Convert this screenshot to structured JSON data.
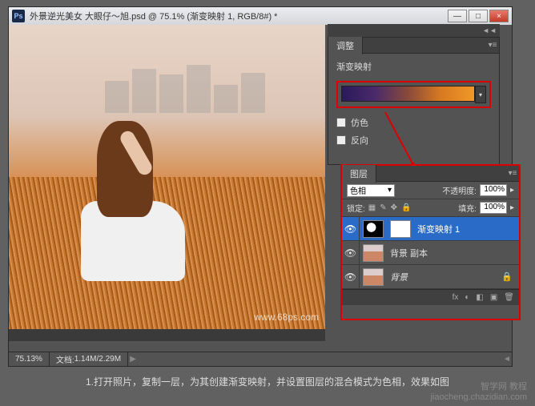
{
  "titlebar": {
    "ps_label": "Ps",
    "doc_title": "外景逆光美女    大眼仔～旭.psd @ 75.1% (渐变映射 1, RGB/8#) *",
    "min": "—",
    "max": "□",
    "close": "×"
  },
  "adj_collapse": "◄◄",
  "adjustments": {
    "tab": "调整",
    "title": "渐变映射",
    "dither": "仿色",
    "reverse": "反向",
    "menu": "▾≡"
  },
  "layers": {
    "tab": "图层",
    "blend_mode": "色相",
    "opacity_label": "不透明度:",
    "opacity_value": "100%",
    "lock_label": "锁定:",
    "fill_label": "填充:",
    "fill_value": "100%",
    "items": [
      {
        "name": "渐变映射 1"
      },
      {
        "name": "背景 副本"
      },
      {
        "name": "背景"
      }
    ],
    "eye": "👁",
    "lock_icon": "🔒",
    "foot_icons": [
      "fx",
      "◐",
      "◧",
      "▣",
      "🗑"
    ]
  },
  "statusbar": {
    "zoom": "75.13%",
    "doc_label": "文档:",
    "doc_size": "1.14M/2.29M",
    "left": "◄",
    "right": "▶"
  },
  "watermark": "www.68ps.com",
  "caption": "1.打开照片，复制一层，为其创建渐变映射，并设置图层的混合模式为色相，效果如图",
  "credit_line1": "智学网 教程",
  "credit_line2": "jiaocheng.chazidian.com",
  "chart_data": {
    "type": "gradient",
    "title": "渐变映射",
    "stops": [
      {
        "pos": 0.0,
        "color": "#2a1a5a"
      },
      {
        "pos": 0.25,
        "color": "#4a2a6a"
      },
      {
        "pos": 0.5,
        "color": "#8a4a3a"
      },
      {
        "pos": 0.75,
        "color": "#d87a20"
      },
      {
        "pos": 1.0,
        "color": "#f09828"
      }
    ]
  }
}
